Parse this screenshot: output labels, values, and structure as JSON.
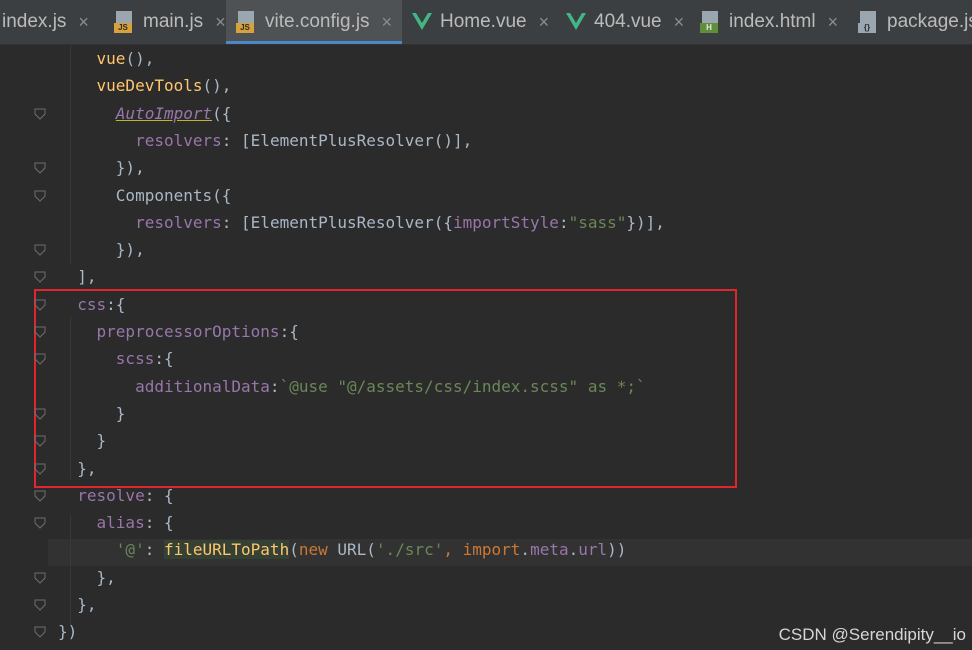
{
  "tabs": [
    {
      "label": "index.js",
      "icon": "none",
      "active": false
    },
    {
      "label": "main.js",
      "icon": "js-file-icon",
      "active": false
    },
    {
      "label": "vite.config.js",
      "icon": "js-file-icon",
      "active": true
    },
    {
      "label": "Home.vue",
      "icon": "vue-icon",
      "active": false
    },
    {
      "label": "404.vue",
      "icon": "vue-icon",
      "active": false
    },
    {
      "label": "index.html",
      "icon": "html-file-icon",
      "active": false
    },
    {
      "label": "package.js",
      "icon": "package-json-icon",
      "active": false
    }
  ],
  "tab_close_glyph": "×",
  "icon_badges": {
    "js": "JS",
    "html": "H",
    "json": "{}"
  },
  "code_lines": [
    [
      [
        "    vue",
        "fn"
      ],
      [
        "(),",
        "plain"
      ]
    ],
    [
      [
        "    vueDevTools",
        "fn"
      ],
      [
        "(),",
        "plain"
      ]
    ],
    [
      [
        "      ",
        "plain"
      ],
      [
        "AutoImport",
        "import"
      ],
      [
        "({",
        "plain"
      ]
    ],
    [
      [
        "        resolvers",
        "prop"
      ],
      [
        ": [",
        "plain"
      ],
      [
        "ElementPlusResolver",
        "plain"
      ],
      [
        "()],",
        "plain"
      ]
    ],
    [
      [
        "      }),",
        "plain"
      ]
    ],
    [
      [
        "      Components",
        "plain"
      ],
      [
        "({",
        "plain"
      ]
    ],
    [
      [
        "        resolvers",
        "prop"
      ],
      [
        ": [",
        "plain"
      ],
      [
        "ElementPlusResolver",
        "plain"
      ],
      [
        "({",
        "plain"
      ],
      [
        "importStyle",
        "prop"
      ],
      [
        ":",
        "plain"
      ],
      [
        "\"sass\"",
        "str"
      ],
      [
        "})],",
        "plain"
      ]
    ],
    [
      [
        "      }),",
        "plain"
      ]
    ],
    [
      [
        "  ],",
        "plain"
      ]
    ],
    [
      [
        "  css",
        "prop"
      ],
      [
        ":{",
        "plain"
      ]
    ],
    [
      [
        "    preprocessorOptions",
        "prop"
      ],
      [
        ":{",
        "plain"
      ]
    ],
    [
      [
        "      scss",
        "prop"
      ],
      [
        ":{",
        "plain"
      ]
    ],
    [
      [
        "        additionalData",
        "prop"
      ],
      [
        ":",
        "plain"
      ],
      [
        "`@use \"@/assets/css/index.scss\" as *;`",
        "str"
      ]
    ],
    [
      [
        "      }",
        "plain"
      ]
    ],
    [
      [
        "    }",
        "plain"
      ]
    ],
    [
      [
        "  },",
        "plain"
      ]
    ],
    [
      [
        "  resolve",
        "prop"
      ],
      [
        ": {",
        "plain"
      ]
    ],
    [
      [
        "    alias",
        "prop"
      ],
      [
        ": {",
        "plain"
      ]
    ],
    [
      [
        "      ",
        "plain"
      ],
      [
        "'@'",
        "str"
      ],
      [
        ": ",
        "plain"
      ],
      [
        "fileURLToPath",
        "hlfn"
      ],
      [
        "(",
        "plain"
      ],
      [
        "new ",
        "kw"
      ],
      [
        "URL",
        "plain"
      ],
      [
        "(",
        "plain"
      ],
      [
        "'./src'",
        "str"
      ],
      [
        ", ",
        "kw"
      ],
      [
        "import",
        "kw"
      ],
      [
        ".",
        "plain"
      ],
      [
        "meta",
        "prop"
      ],
      [
        ".",
        "plain"
      ],
      [
        "url",
        "prop"
      ],
      [
        "))",
        "plain"
      ]
    ],
    [
      [
        "    },",
        "plain"
      ]
    ],
    [
      [
        "  },",
        "plain"
      ]
    ],
    [
      [
        "})",
        "plain"
      ]
    ]
  ],
  "watermark": "CSDN @Serendipity__io",
  "colors": {
    "background": "#2b2b2b",
    "tabbar": "#3c3f41",
    "active_tab_underline": "#4a88c7",
    "annotation_box": "#e0262c",
    "vue_green": "#41b883"
  }
}
